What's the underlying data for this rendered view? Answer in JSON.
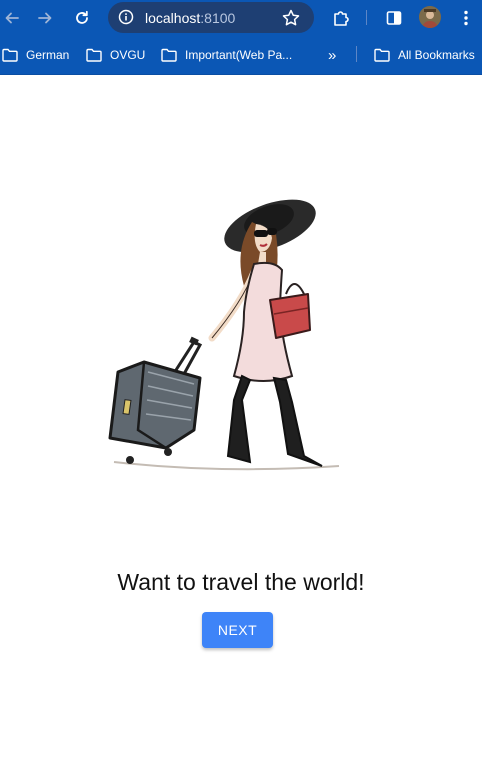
{
  "browser": {
    "back_icon": "arrow-left-icon",
    "forward_icon": "arrow-right-icon",
    "reload_icon": "reload-icon",
    "url_host": "localhost",
    "url_port": ":8100",
    "bookmark_star_icon": "star-icon",
    "extensions_icon": "puzzle-icon",
    "sidepanel_icon": "side-panel-icon",
    "menu_icon": "kebab-menu-icon",
    "toolbar_color": "#0b57b5"
  },
  "bookmarks": {
    "items": [
      {
        "label": "German"
      },
      {
        "label": "OVGU"
      },
      {
        "label": "Important(Web Pa..."
      }
    ],
    "overflow_label": "»",
    "all_bookmarks_label": "All Bookmarks"
  },
  "page": {
    "illustration": "woman-traveler-with-suitcase-illustration",
    "headline": "Want to travel the world!",
    "next_button_label": "NEXT",
    "button_color": "#3e84f8"
  }
}
